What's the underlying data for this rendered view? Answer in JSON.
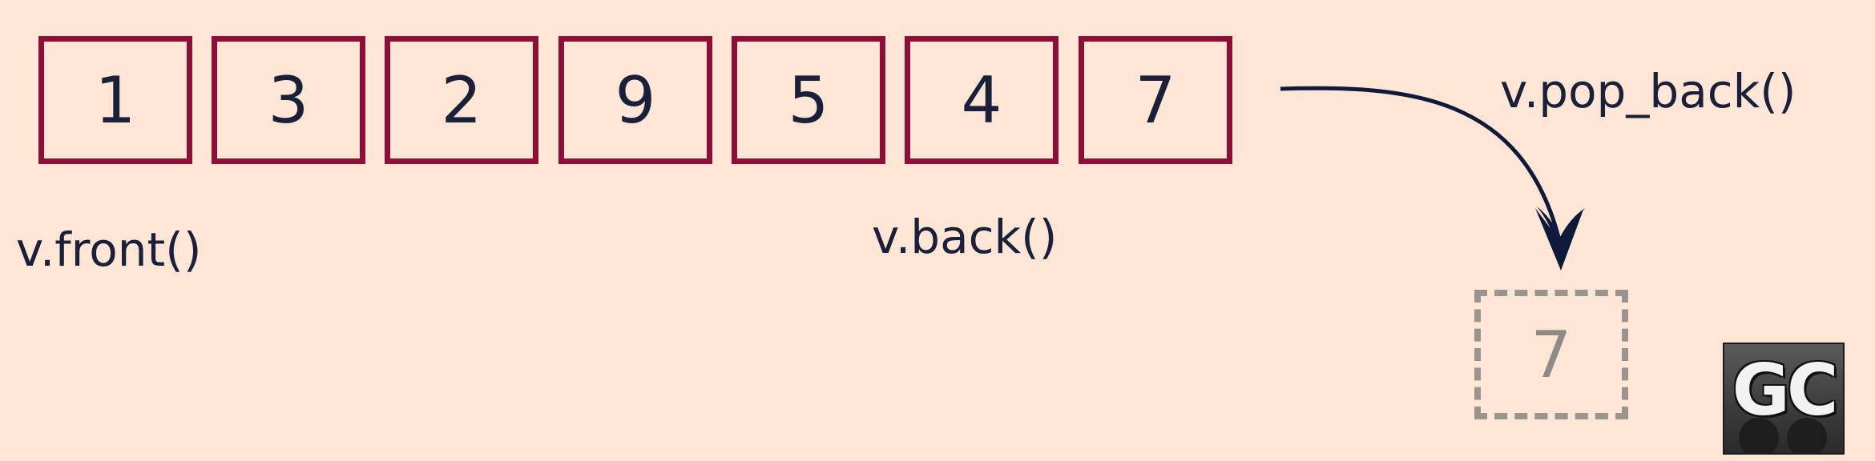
{
  "vector": {
    "cells": [
      "1",
      "3",
      "2",
      "9",
      "5",
      "4",
      "7"
    ]
  },
  "labels": {
    "front": "v.front()",
    "back": "v.back()",
    "pop_back": "v.pop_back()"
  },
  "popped": {
    "value": "7"
  },
  "logo": {
    "text": "GC"
  },
  "colors": {
    "background": "#fde6d6",
    "cell_border": "#8e0e38",
    "text": "#1a1f3a",
    "popped_border": "#9a948f"
  }
}
